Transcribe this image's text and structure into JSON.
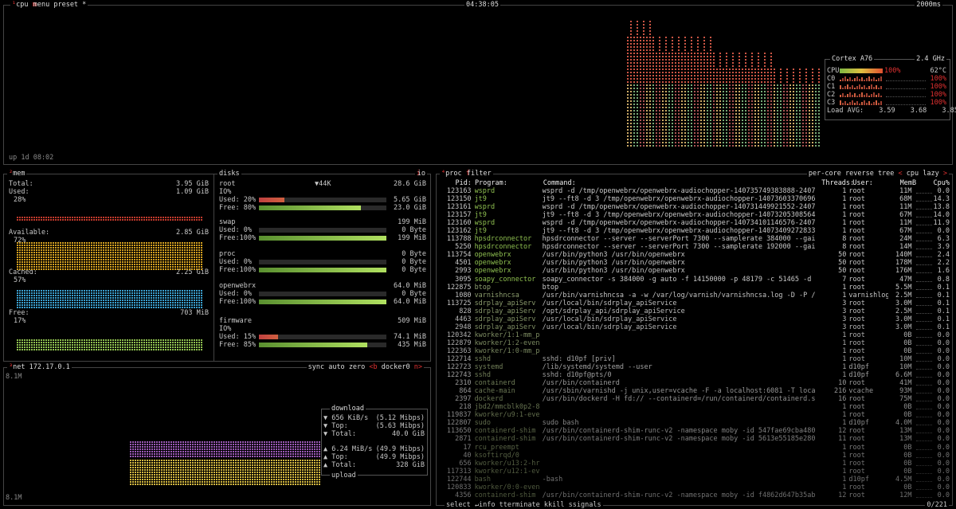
{
  "cpu": {
    "title": "cpu",
    "menu": "menu",
    "preset": "preset *",
    "clock": "04:38:05",
    "interval": "2000ms",
    "uptime": "up 1d 08:02",
    "model": "Cortex A76",
    "freq": "2.4 GHz",
    "total": {
      "label": "CPU",
      "percent": "100%",
      "temp": "62°C",
      "value": 1.0
    },
    "cores": [
      {
        "label": "C0",
        "percent": "100%",
        "value": 1.0
      },
      {
        "label": "C1",
        "percent": "100%",
        "value": 1.0
      },
      {
        "label": "C2",
        "percent": "100%",
        "value": 1.0
      },
      {
        "label": "C3",
        "percent": "100%",
        "value": 1.0
      }
    ],
    "load_label": "Load AVG:",
    "load": [
      "3.59",
      "3.68",
      "3.85"
    ]
  },
  "mem": {
    "title": "mem",
    "total_label": "Total:",
    "total_value": "3.95 GiB",
    "used_label": "Used:",
    "used_value": "1.09 GiB",
    "used_pct": "28%",
    "available_label": "Available:",
    "available_value": "2.85 GiB",
    "available_pct": "72%",
    "cached_label": "Cached:",
    "cached_value": "2.25 GiB",
    "cached_pct": "57%",
    "free_label": "Free:",
    "free_value": "703 MiB",
    "free_pct": "17%"
  },
  "disks": {
    "title": "disks",
    "io": "io",
    "items": [
      {
        "name": "root",
        "speed": "▼44K",
        "size": "28.6 GiB",
        "io": "IO%",
        "used_label": "Used: 20%",
        "used_value": "5.65 GiB",
        "used": 0.2,
        "free_label": "Free: 80%",
        "free_value": "23.0 GiB",
        "free": 0.8
      },
      {
        "name": "swap",
        "speed": "",
        "size": "199 MiB",
        "io": "",
        "used_label": "Used:  0%",
        "used_value": "0 Byte",
        "used": 0.0,
        "free_label": "Free:100%",
        "free_value": "199 MiB",
        "free": 1.0
      },
      {
        "name": "proc",
        "speed": "",
        "size": "0 Byte",
        "io": "",
        "used_label": "Used:  0%",
        "used_value": "0 Byte",
        "used": 0.0,
        "free_label": "Free:100%",
        "free_value": "0 Byte",
        "free": 1.0
      },
      {
        "name": "openwebrx",
        "speed": "",
        "size": "64.0 MiB",
        "io": "",
        "used_label": "Used:  0%",
        "used_value": "0 Byte",
        "used": 0.0,
        "free_label": "Free:100%",
        "free_value": "64.0 MiB",
        "free": 1.0
      },
      {
        "name": "firmware",
        "speed": "",
        "size": "509 MiB",
        "io": "IO%",
        "used_label": "Used: 15%",
        "used_value": "74.1 MiB",
        "used": 0.15,
        "free_label": "Free: 85%",
        "free_value": "435 MiB",
        "free": 0.85
      }
    ]
  },
  "net": {
    "title": "net",
    "ip": "172.17.0.1",
    "sync": "sync",
    "auto": "auto",
    "zero": "zero",
    "iface_prev": "<b",
    "iface": "docker0",
    "iface_next": "n>",
    "scale_top": "8.1M",
    "scale_bottom": "8.1M",
    "download_label": "download",
    "dl_rate": "▼ 656 KiB/s",
    "dl_rate_b": "(5.12 Mibps)",
    "dl_top": "▼ Top:",
    "dl_top_b": "(5.63 Mibps)",
    "dl_total": "▼ Total:",
    "dl_total_b": "40.0 GiB",
    "ul_rate": "▲ 6.24 MiB/s",
    "ul_rate_b": "(49.9 Mibps)",
    "ul_top": "▲ Top:",
    "ul_top_b": "(49.9 Mibps)",
    "ul_total": "▲ Total:",
    "ul_total_b": "328 GiB",
    "upload_label": "upload"
  },
  "proc": {
    "title": "proc",
    "filter": "filter",
    "per_core": "per-core",
    "reverse": "reverse",
    "tree": "tree",
    "sort_prev": "<",
    "sort": "cpu lazy",
    "sort_next": ">",
    "headers": {
      "pid": "Pid:",
      "program": "Program:",
      "command": "Command:",
      "threads": "Threads:",
      "user": "User:",
      "mem": "MemB",
      "cpu": "Cpu%"
    },
    "rows": [
      {
        "pid": "123163",
        "program": "wsprd",
        "command": "wsprd -d /tmp/openwebrx/openwebrx-audiochopper-140735749383888-2407",
        "threads": "1",
        "user": "root",
        "mem": "11M",
        "cpu": "0.0"
      },
      {
        "pid": "123150",
        "program": "jt9",
        "command": "jt9 --ft8 -d 3 /tmp/openwebrx/openwebrx-audiochopper-14073603370696",
        "threads": "1",
        "user": "root",
        "mem": "68M",
        "cpu": "14.3"
      },
      {
        "pid": "123161",
        "program": "wsprd",
        "command": "wsprd -d /tmp/openwebrx/openwebrx-audiochopper-140731449921552-2407",
        "threads": "1",
        "user": "root",
        "mem": "11M",
        "cpu": "13.8"
      },
      {
        "pid": "123157",
        "program": "jt9",
        "command": "jt9 --ft8 -d 3 /tmp/openwebrx/openwebrx-audiochopper-14073205308564",
        "threads": "1",
        "user": "root",
        "mem": "67M",
        "cpu": "14.0"
      },
      {
        "pid": "123160",
        "program": "wsprd",
        "command": "wsprd -d /tmp/openwebrx/openwebrx-audiochopper-140734101146576-2407",
        "threads": "1",
        "user": "root",
        "mem": "11M",
        "cpu": "11.9"
      },
      {
        "pid": "123162",
        "program": "jt9",
        "command": "jt9 --ft8 -d 3 /tmp/openwebrx/openwebrx-audiochopper-14073409272833",
        "threads": "1",
        "user": "root",
        "mem": "67M",
        "cpu": "0.0"
      },
      {
        "pid": "113788",
        "program": "hpsdrconnector",
        "command": "hpsdrconnector --server --serverPort 7300 --samplerate 384000 --gai",
        "threads": "8",
        "user": "root",
        "mem": "24M",
        "cpu": "6.3"
      },
      {
        "pid": "5250",
        "program": "hpsdrconnector",
        "command": "hpsdrconnector --server --serverPort 7300 --samplerate 192000 --gai",
        "threads": "8",
        "user": "root",
        "mem": "14M",
        "cpu": "3.9"
      },
      {
        "pid": "113754",
        "program": "openwebrx",
        "command": "/usr/bin/python3 /usr/bin/openwebrx",
        "threads": "50",
        "user": "root",
        "mem": "140M",
        "cpu": "2.4"
      },
      {
        "pid": "4501",
        "program": "openwebrx",
        "command": "/usr/bin/python3 /usr/bin/openwebrx",
        "threads": "50",
        "user": "root",
        "mem": "178M",
        "cpu": "2.2"
      },
      {
        "pid": "2993",
        "program": "openwebrx",
        "command": "/usr/bin/python3 /usr/bin/openwebrx",
        "threads": "50",
        "user": "root",
        "mem": "176M",
        "cpu": "1.6"
      },
      {
        "pid": "3095",
        "program": "soapy_connector",
        "command": "soapy_connector -s 384000 -g auto -f 14150000 -p 48179 -c 51465 -d",
        "threads": "7",
        "user": "root",
        "mem": "47M",
        "cpu": "0.8"
      },
      {
        "pid": "122875",
        "program": "btop",
        "command": "btop",
        "threads": "1",
        "user": "root",
        "mem": "5.5M",
        "cpu": "0.1"
      },
      {
        "pid": "1080",
        "program": "varnishncsa",
        "command": "/usr/bin/varnishncsa -a -w /var/log/varnish/varnishncsa.log -D -P /",
        "threads": "1",
        "user": "varnishlog",
        "mem": "2.5M",
        "cpu": "0.1"
      },
      {
        "pid": "113725",
        "program": "sdrplay_apiServ",
        "command": "/usr/local/bin/sdrplay_apiService",
        "threads": "3",
        "user": "root",
        "mem": "3.0M",
        "cpu": "0.1"
      },
      {
        "pid": "828",
        "program": "sdrplay_apiServ",
        "command": "/opt/sdrplay_api/sdrplay_apiService",
        "threads": "3",
        "user": "root",
        "mem": "2.5M",
        "cpu": "0.1"
      },
      {
        "pid": "4463",
        "program": "sdrplay_apiServ",
        "command": "/usr/local/bin/sdrplay_apiService",
        "threads": "3",
        "user": "root",
        "mem": "3.0M",
        "cpu": "0.1"
      },
      {
        "pid": "2948",
        "program": "sdrplay_apiServ",
        "command": "/usr/local/bin/sdrplay_apiService",
        "threads": "3",
        "user": "root",
        "mem": "3.0M",
        "cpu": "0.1"
      },
      {
        "pid": "120342",
        "program": "kworker/1:1-mm_p",
        "command": "",
        "threads": "1",
        "user": "root",
        "mem": "0B",
        "cpu": "0.0"
      },
      {
        "pid": "122879",
        "program": "kworker/1:2-even",
        "command": "",
        "threads": "1",
        "user": "root",
        "mem": "0B",
        "cpu": "0.0"
      },
      {
        "pid": "122363",
        "program": "kworker/1:0-mm_p",
        "command": "",
        "threads": "1",
        "user": "root",
        "mem": "0B",
        "cpu": "0.0"
      },
      {
        "pid": "122714",
        "program": "sshd",
        "command": "sshd: d10pf [priv]",
        "threads": "1",
        "user": "root",
        "mem": "10M",
        "cpu": "0.0"
      },
      {
        "pid": "122723",
        "program": "systemd",
        "command": "/lib/systemd/systemd --user",
        "threads": "1",
        "user": "d10pf",
        "mem": "10M",
        "cpu": "0.0"
      },
      {
        "pid": "122743",
        "program": "sshd",
        "command": "sshd: d10pf@pts/0",
        "threads": "1",
        "user": "d10pf",
        "mem": "6.6M",
        "cpu": "0.0"
      },
      {
        "pid": "2310",
        "program": "containerd",
        "command": "/usr/bin/containerd",
        "threads": "10",
        "user": "root",
        "mem": "41M",
        "cpu": "0.0"
      },
      {
        "pid": "864",
        "program": "cache-main",
        "command": "/usr/sbin/varnishd -j unix,user=vcache -F -a localhost:6081 -T loca",
        "threads": "216",
        "user": "vcache",
        "mem": "93M",
        "cpu": "0.0"
      },
      {
        "pid": "2397",
        "program": "dockerd",
        "command": "/usr/bin/dockerd -H fd:// --containerd=/run/containerd/containerd.s",
        "threads": "16",
        "user": "root",
        "mem": "75M",
        "cpu": "0.0"
      },
      {
        "pid": "218",
        "program": "jbd2/mmcblk0p2-8",
        "command": "",
        "threads": "1",
        "user": "root",
        "mem": "0B",
        "cpu": "0.0"
      },
      {
        "pid": "119837",
        "program": "kworker/u9:1-eve",
        "command": "",
        "threads": "1",
        "user": "root",
        "mem": "0B",
        "cpu": "0.0"
      },
      {
        "pid": "122807",
        "program": "sudo",
        "command": "sudo bash",
        "threads": "1",
        "user": "d10pf",
        "mem": "4.0M",
        "cpu": "0.0"
      },
      {
        "pid": "113650",
        "program": "containerd-shim",
        "command": "/usr/bin/containerd-shim-runc-v2 -namespace moby -id 547fae69cba480",
        "threads": "12",
        "user": "root",
        "mem": "13M",
        "cpu": "0.0"
      },
      {
        "pid": "2871",
        "program": "containerd-shim",
        "command": "/usr/bin/containerd-shim-runc-v2 -namespace moby -id 5613e55185e280",
        "threads": "11",
        "user": "root",
        "mem": "13M",
        "cpu": "0.0"
      },
      {
        "pid": "17",
        "program": "rcu_preempt",
        "command": "",
        "threads": "1",
        "user": "root",
        "mem": "0B",
        "cpu": "0.0"
      },
      {
        "pid": "40",
        "program": "ksoftirqd/0",
        "command": "",
        "threads": "1",
        "user": "root",
        "mem": "0B",
        "cpu": "0.0"
      },
      {
        "pid": "656",
        "program": "kworker/u13:2-hr",
        "command": "",
        "threads": "1",
        "user": "root",
        "mem": "0B",
        "cpu": "0.0"
      },
      {
        "pid": "117313",
        "program": "kworker/u12:1-ev",
        "command": "",
        "threads": "1",
        "user": "root",
        "mem": "0B",
        "cpu": "0.0"
      },
      {
        "pid": "122744",
        "program": "bash",
        "command": "-bash",
        "threads": "1",
        "user": "d10pf",
        "mem": "4.5M",
        "cpu": "0.0"
      },
      {
        "pid": "120833",
        "program": "kworker/0:0-even",
        "command": "",
        "threads": "1",
        "user": "root",
        "mem": "0B",
        "cpu": "0.0"
      },
      {
        "pid": "4356",
        "program": "containerd-shim",
        "command": "/usr/bin/containerd-shim-runc-v2 -namespace moby -id f4862d647b35ab",
        "threads": "12",
        "user": "root",
        "mem": "12M",
        "cpu": "0.0"
      }
    ],
    "footer": {
      "select": "select",
      "info": "info",
      "terminate": "terminate",
      "kill": "kill",
      "signals": "signals",
      "count": "0/221"
    }
  },
  "colors": {
    "border": "#444444",
    "hotkey": "#e03030",
    "mem_used": "#c0392b",
    "mem_avail": "#d4a020",
    "mem_cached": "#3aa0d0",
    "mem_free": "#8fc050",
    "net_dl": "#9b59b6",
    "net_ul": "#d4b840"
  }
}
